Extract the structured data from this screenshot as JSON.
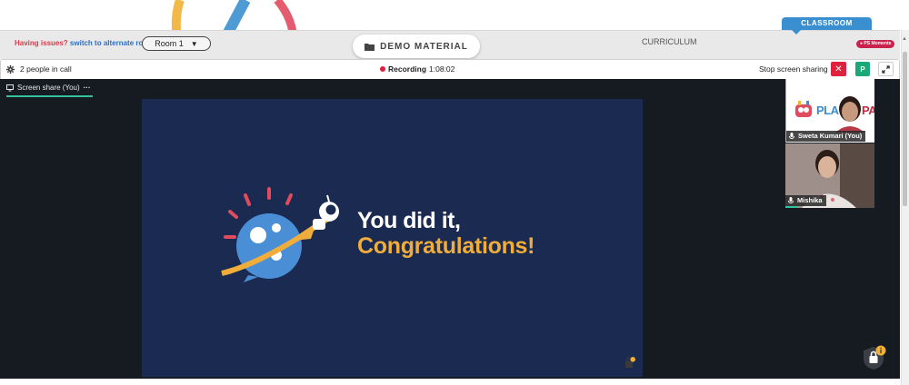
{
  "header": {
    "issues_text": "Having issues?",
    "alt_room_link": "switch to alternate room",
    "room_select_value": "Room 1",
    "demo_material_label": "DEMO MATERIAL",
    "curriculum_label": "CURRICULUM",
    "classroom_tab_label": "CLASSROOM",
    "moments_badge": "PS Moments"
  },
  "callbar": {
    "people_count": "2 people in call",
    "recording_label": "Recording",
    "recording_time": "1:08:02",
    "stop_sharing_label": "Stop screen sharing",
    "close_glyph": "✕",
    "participant_initial": "P"
  },
  "stage": {
    "screen_share_tab": "Screen share (You)",
    "more_glyph": "···",
    "slide_line1": "You did it,",
    "slide_line2": "Congratulations!"
  },
  "participants": [
    {
      "name": "Sweta Kumari (You)",
      "logo_text_left": "PLA",
      "logo_text_right": "PARK"
    },
    {
      "name": "Mishika"
    }
  ],
  "colors": {
    "brand_red": "#e0213d",
    "accent_teal": "#33c2a0",
    "slide_bg": "#1a2a50",
    "congrats_yellow": "#f0ad3c",
    "classroom_blue": "#3a8fd0"
  }
}
